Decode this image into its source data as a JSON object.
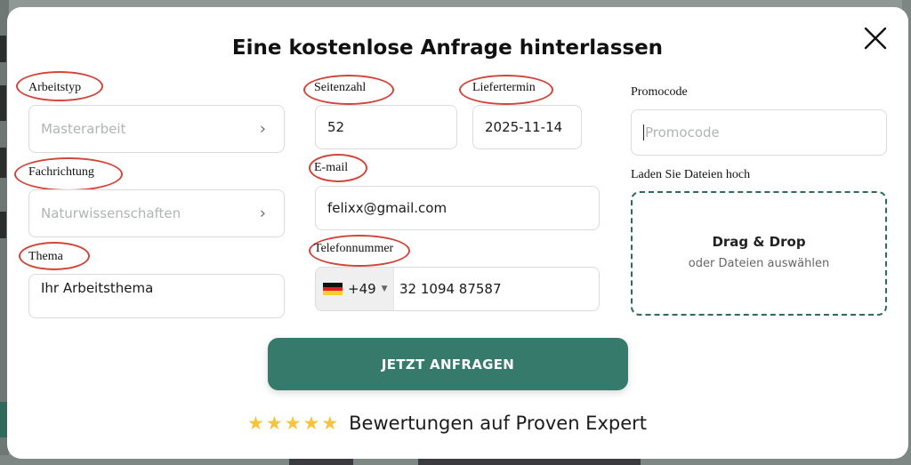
{
  "title": "Eine kostenlose Anfrage hinterlassen",
  "labels": {
    "work_type": "Arbeitstyp",
    "field": "Fachrichtung",
    "topic": "Thema",
    "pages": "Seitenzahl",
    "deadline": "Liefertermin",
    "email": "E-mail",
    "phone": "Telefonnummer",
    "promo": "Promocode",
    "upload": "Laden Sie Dateien hoch"
  },
  "fields": {
    "work_type": "Masterarbeit",
    "field": "Naturwissenschaften",
    "topic_value": "Ihr Arbeitsthema",
    "pages_value": "52",
    "deadline_value": "2025-11-14",
    "email_value": "felixx@gmail.com",
    "phone_code": "+49",
    "phone_value": "32 1094 87587",
    "promo_placeholder": "Promocode"
  },
  "upload": {
    "title": "Drag & Drop",
    "subtitle": "oder Dateien auswählen"
  },
  "submit_label": "JETZT ANFRAGEN",
  "rating": {
    "stars": 5,
    "text": "Bewertungen auf Proven Expert"
  },
  "colors": {
    "accent": "#367a6c",
    "annotation": "#d1453b",
    "star": "#f6c33a"
  },
  "icons": {
    "close": "close-icon",
    "chevron": "chevron-right-icon",
    "flag": "germany-flag-icon",
    "star": "star-icon"
  }
}
